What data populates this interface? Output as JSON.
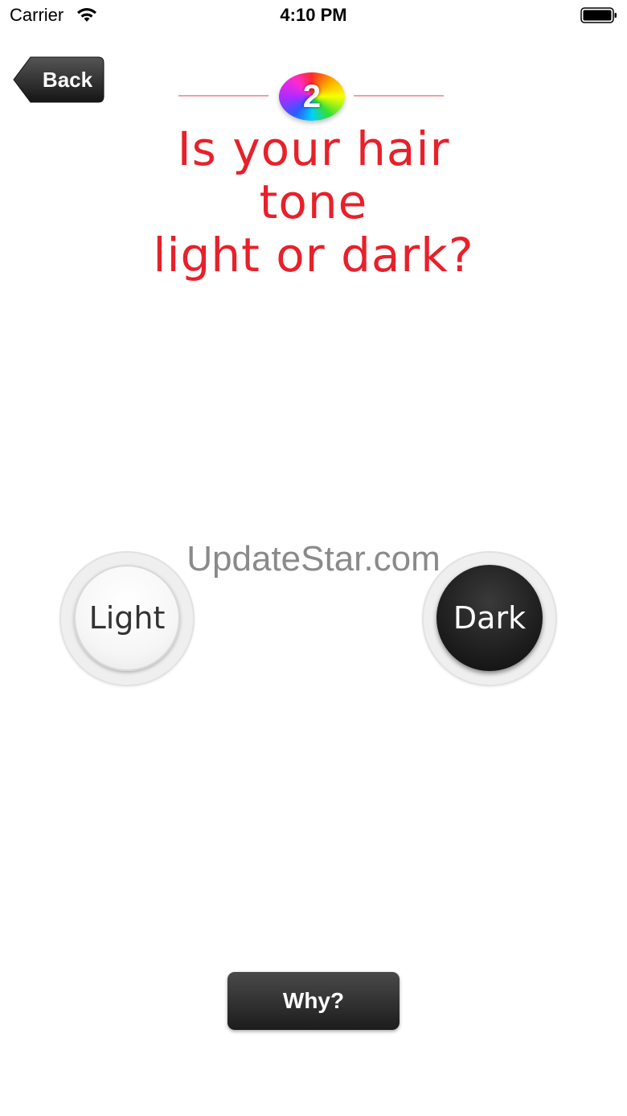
{
  "status_bar": {
    "carrier": "Carrier",
    "time": "4:10 PM",
    "wifi_icon": "wifi-icon",
    "battery_icon": "battery-icon"
  },
  "nav": {
    "back_label": "Back"
  },
  "step": {
    "number": "2"
  },
  "question": {
    "lines": [
      "Is your hair",
      "tone",
      "light or dark?"
    ]
  },
  "watermark": "UpdateStar.com",
  "choices": {
    "light": {
      "label": "Light"
    },
    "dark": {
      "label": "Dark"
    }
  },
  "why_button": {
    "label": "Why?"
  },
  "colors": {
    "question_text": "#e8202a",
    "rule": "#f0a0a0",
    "button_dark": "#1c1c1c"
  }
}
